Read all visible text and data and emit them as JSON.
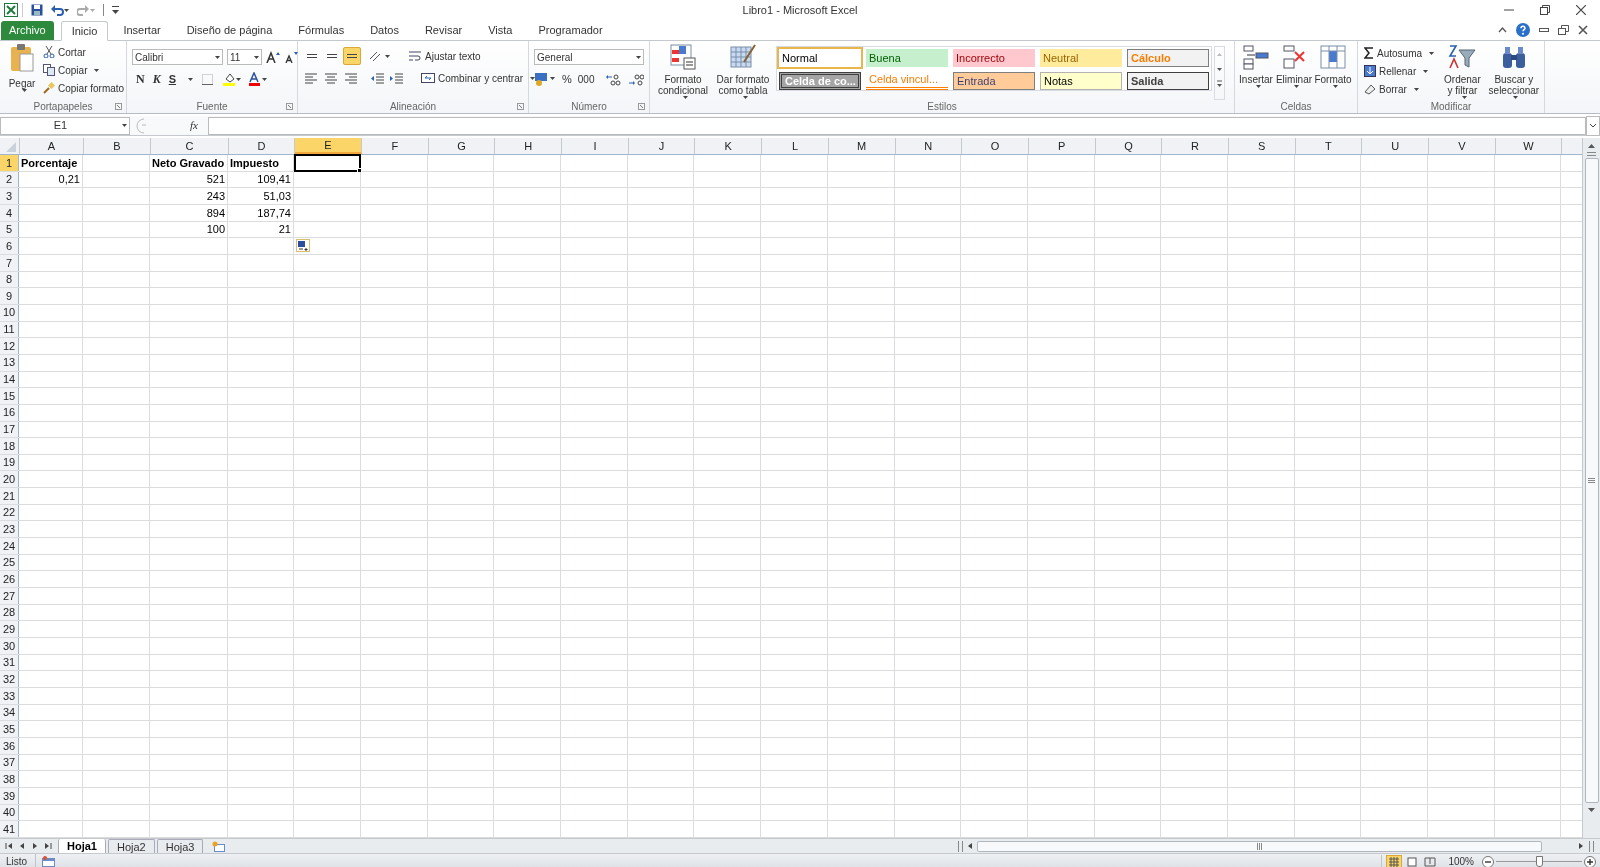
{
  "window": {
    "title": "Libro1  -  Microsoft Excel"
  },
  "tabs": [
    {
      "label": "Archivo",
      "kind": "file",
      "selected": false
    },
    {
      "label": "Inicio",
      "kind": "tab",
      "selected": true
    },
    {
      "label": "Insertar",
      "kind": "tab",
      "selected": false
    },
    {
      "label": "Diseño de página",
      "kind": "tab",
      "selected": false
    },
    {
      "label": "Fórmulas",
      "kind": "tab",
      "selected": false
    },
    {
      "label": "Datos",
      "kind": "tab",
      "selected": false
    },
    {
      "label": "Revisar",
      "kind": "tab",
      "selected": false
    },
    {
      "label": "Vista",
      "kind": "tab",
      "selected": false
    },
    {
      "label": "Programador",
      "kind": "tab",
      "selected": false
    }
  ],
  "ribbon": {
    "clipboard": {
      "label": "Portapapeles",
      "paste": "Pegar",
      "cut": "Cortar",
      "copy": "Copiar",
      "format_painter": "Copiar formato"
    },
    "font": {
      "label": "Fuente",
      "font_name": "Calibri",
      "font_size": "11",
      "bold": "N",
      "italic": "K",
      "underline": "S"
    },
    "alignment": {
      "label": "Alineación",
      "vertical_align": [
        {
          "selected": false
        },
        {
          "selected": false
        },
        {
          "selected": true
        }
      ],
      "wrap_text": "Ajustar texto",
      "merge_center": "Combinar y centrar"
    },
    "number": {
      "label": "Número",
      "format": "General",
      "percent": "%",
      "thousands": "000"
    },
    "styles": {
      "label": "Estilos",
      "conditional_format": "Formato condicional",
      "format_as_table": "Dar formato como tabla",
      "cell_styles": [
        {
          "label": "Normal",
          "kind": "normal",
          "selected": true
        },
        {
          "label": "Buena",
          "kind": "good",
          "selected": false
        },
        {
          "label": "Incorrecto",
          "kind": "bad",
          "selected": false
        },
        {
          "label": "Neutral",
          "kind": "neutral",
          "selected": false
        },
        {
          "label": "Cálculo",
          "kind": "calc",
          "selected": false
        },
        {
          "label": "Celda de co...",
          "kind": "check",
          "selected": false
        },
        {
          "label": "Celda vincul...",
          "kind": "linked",
          "selected": false
        },
        {
          "label": "Entrada",
          "kind": "input",
          "selected": false
        },
        {
          "label": "Notas",
          "kind": "note",
          "selected": false
        },
        {
          "label": "Salida",
          "kind": "output",
          "selected": false
        }
      ]
    },
    "cells": {
      "label": "Celdas",
      "insert": "Insertar",
      "delete": "Eliminar",
      "format": "Formato"
    },
    "editing": {
      "label": "Modificar",
      "autosum": "Autosuma",
      "fill": "Rellenar",
      "clear": "Borrar",
      "sort_filter": "Ordenar y filtrar",
      "find_select": "Buscar y seleccionar"
    }
  },
  "formula_bar": {
    "name_box": "E1",
    "fx": "fx"
  },
  "sheet": {
    "columns": [
      {
        "label": "A",
        "selected": false
      },
      {
        "label": "B",
        "selected": false
      },
      {
        "label": "C",
        "selected": false
      },
      {
        "label": "D",
        "selected": false
      },
      {
        "label": "E",
        "selected": true
      },
      {
        "label": "F",
        "selected": false
      },
      {
        "label": "G",
        "selected": false
      },
      {
        "label": "H",
        "selected": false
      },
      {
        "label": "I",
        "selected": false
      },
      {
        "label": "J",
        "selected": false
      },
      {
        "label": "K",
        "selected": false
      },
      {
        "label": "L",
        "selected": false
      },
      {
        "label": "M",
        "selected": false
      },
      {
        "label": "N",
        "selected": false
      },
      {
        "label": "O",
        "selected": false
      },
      {
        "label": "P",
        "selected": false
      },
      {
        "label": "Q",
        "selected": false
      },
      {
        "label": "R",
        "selected": false
      },
      {
        "label": "S",
        "selected": false
      },
      {
        "label": "T",
        "selected": false
      },
      {
        "label": "U",
        "selected": false
      },
      {
        "label": "V",
        "selected": false
      },
      {
        "label": "W",
        "selected": false
      }
    ],
    "rows": [
      {
        "label": "1",
        "selected": true,
        "bold": true,
        "cells": [
          "Porcentaje",
          null,
          "Neto Gravado",
          "Impuesto"
        ]
      },
      {
        "label": "2",
        "selected": false,
        "bold": false,
        "cells": [
          "0,21",
          null,
          "521",
          "109,41"
        ]
      },
      {
        "label": "3",
        "selected": false,
        "bold": false,
        "cells": [
          null,
          null,
          "243",
          "51,03"
        ]
      },
      {
        "label": "4",
        "selected": false,
        "bold": false,
        "cells": [
          null,
          null,
          "894",
          "187,74"
        ]
      },
      {
        "label": "5",
        "selected": false,
        "bold": false,
        "cells": [
          null,
          null,
          "100",
          "21"
        ]
      },
      {
        "label": "6",
        "selected": false
      },
      {
        "label": "7",
        "selected": false
      },
      {
        "label": "8",
        "selected": false
      },
      {
        "label": "9",
        "selected": false
      },
      {
        "label": "10",
        "selected": false
      },
      {
        "label": "11",
        "selected": false
      },
      {
        "label": "12",
        "selected": false
      },
      {
        "label": "13",
        "selected": false
      },
      {
        "label": "14",
        "selected": false
      },
      {
        "label": "15",
        "selected": false
      },
      {
        "label": "16",
        "selected": false
      },
      {
        "label": "17",
        "selected": false
      },
      {
        "label": "18",
        "selected": false
      },
      {
        "label": "19",
        "selected": false
      },
      {
        "label": "20",
        "selected": false
      },
      {
        "label": "21",
        "selected": false
      },
      {
        "label": "22",
        "selected": false
      },
      {
        "label": "23",
        "selected": false
      },
      {
        "label": "24",
        "selected": false
      },
      {
        "label": "25",
        "selected": false
      },
      {
        "label": "26",
        "selected": false
      },
      {
        "label": "27",
        "selected": false
      },
      {
        "label": "28",
        "selected": false
      },
      {
        "label": "29",
        "selected": false
      },
      {
        "label": "30",
        "selected": false
      },
      {
        "label": "31",
        "selected": false
      },
      {
        "label": "32",
        "selected": false
      },
      {
        "label": "33",
        "selected": false
      },
      {
        "label": "34",
        "selected": false
      },
      {
        "label": "35",
        "selected": false
      },
      {
        "label": "36",
        "selected": false
      },
      {
        "label": "37",
        "selected": false
      },
      {
        "label": "38",
        "selected": false
      },
      {
        "label": "39",
        "selected": false
      },
      {
        "label": "40",
        "selected": false
      },
      {
        "label": "41",
        "selected": false
      }
    ]
  },
  "sheet_tabs": [
    {
      "label": "Hoja1",
      "selected": true
    },
    {
      "label": "Hoja2",
      "selected": false
    },
    {
      "label": "Hoja3",
      "selected": false
    }
  ],
  "status_bar": {
    "status": "Listo",
    "views": [
      {
        "selected": true
      },
      {
        "selected": false
      },
      {
        "selected": false
      }
    ],
    "zoom": "100%",
    "zoom_slider": {
      "level": 0.5
    }
  }
}
